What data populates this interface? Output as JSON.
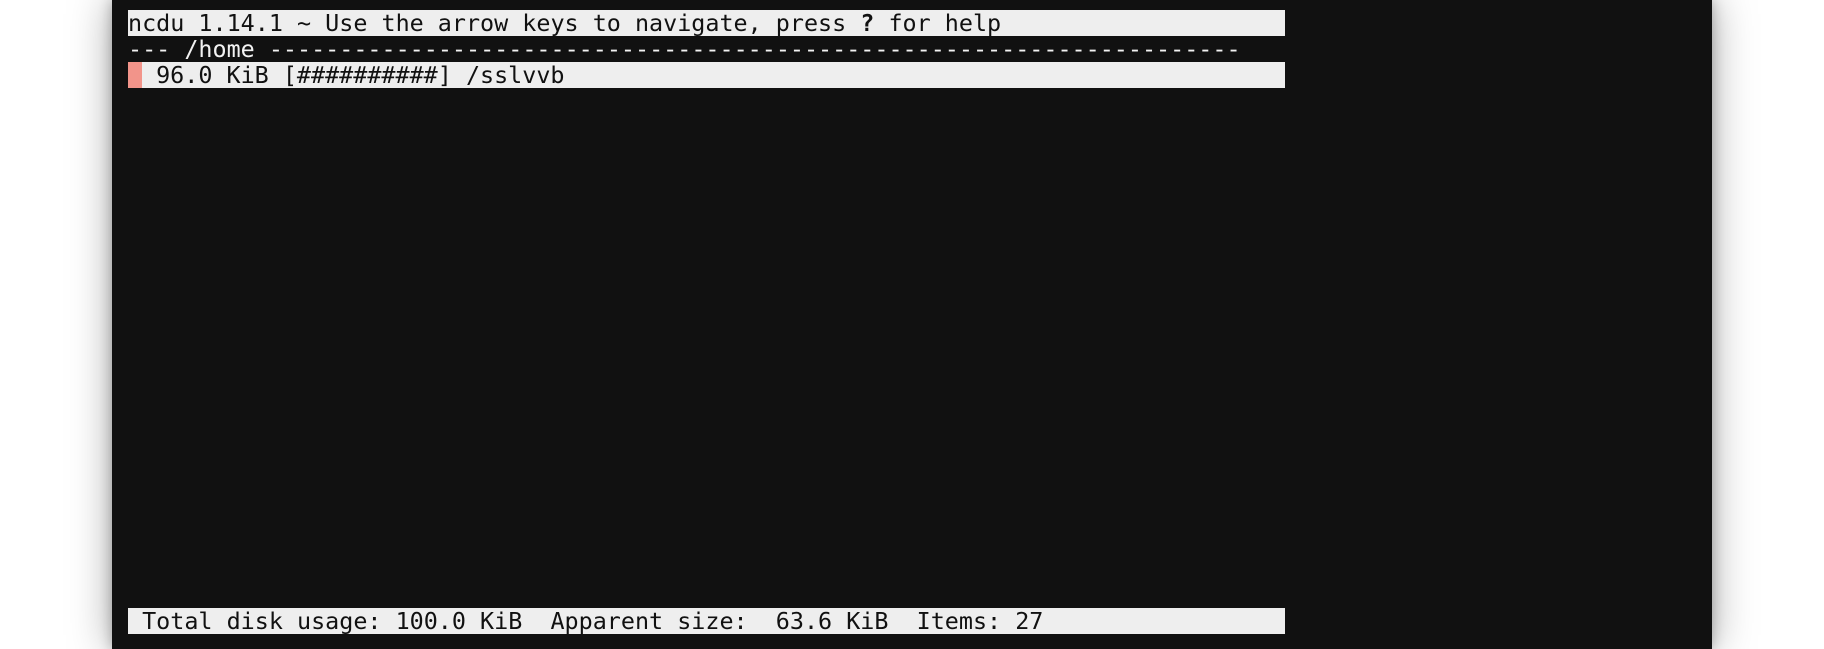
{
  "header": {
    "before_key": "ncdu 1.14.1 ~ Use the arrow keys to navigate, press ",
    "help_key": "?",
    "after_key": " for help"
  },
  "path_bar": {
    "prefix": "--- ",
    "path": "/home",
    "suffix": " ---------------------------------------------------------------------"
  },
  "entries": [
    {
      "size": " 96.0 KiB",
      "bar": "[##########]",
      "name": "/sslvvb",
      "selected": true
    }
  ],
  "status": {
    "text": " Total disk usage: 100.0 KiB  Apparent size:  63.6 KiB  Items: 27"
  },
  "colors": {
    "terminal_bg": "#111111",
    "inverse_bg": "#eeeeee",
    "selection_marker": "#f2948a"
  }
}
